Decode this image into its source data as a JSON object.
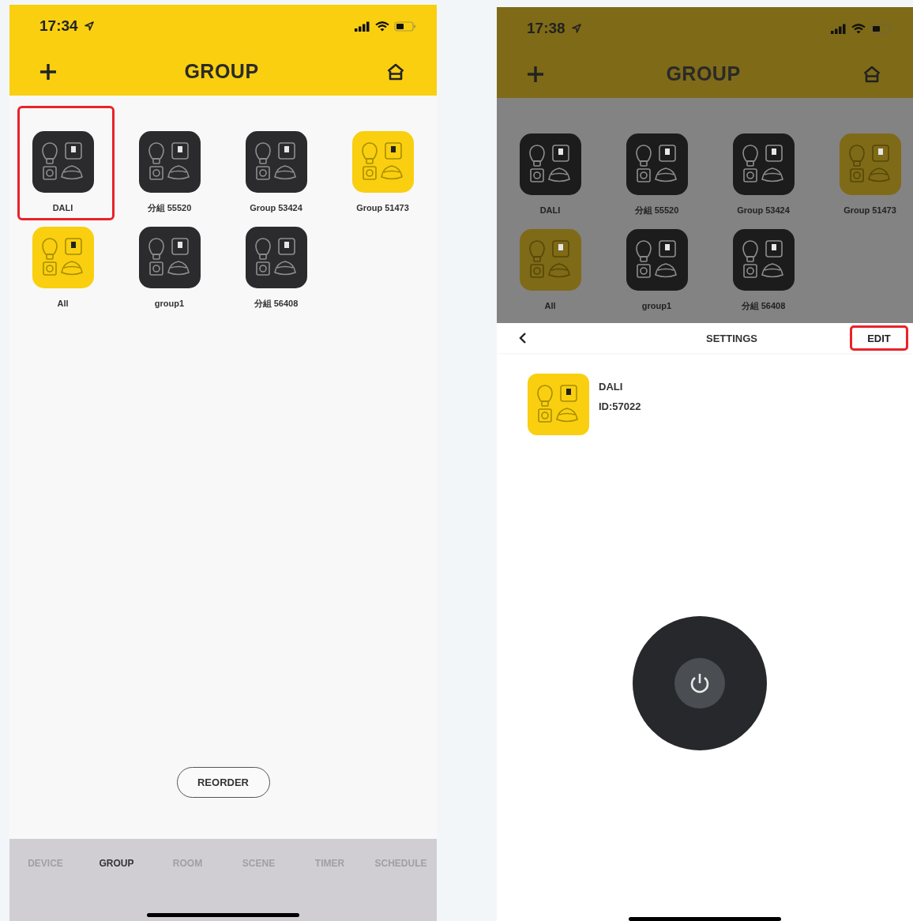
{
  "screens": [
    {
      "status_bar": {
        "time": "17:34"
      },
      "header": {
        "title": "GROUP"
      },
      "dimmed": false,
      "groups": [
        {
          "name": "DALI",
          "color": "#2b2b2d",
          "highlighted": true
        },
        {
          "name": "分組 55520",
          "color": "#2b2b2d",
          "highlighted": false
        },
        {
          "name": "Group 53424",
          "color": "#2b2b2d",
          "highlighted": false
        },
        {
          "name": "Group 51473",
          "color": "#f9cf10",
          "highlighted": false
        },
        {
          "name": "All",
          "color": "#f9cf10",
          "highlighted": false
        },
        {
          "name": "group1",
          "color": "#2b2b2d",
          "highlighted": false
        },
        {
          "name": "分組 56408",
          "color": "#2b2b2d",
          "highlighted": false
        }
      ],
      "reorder_button": "REORDER",
      "tab_bar": [
        {
          "label": "DEVICE",
          "selected": false
        },
        {
          "label": "GROUP",
          "selected": true
        },
        {
          "label": "ROOM",
          "selected": false
        },
        {
          "label": "SCENE",
          "selected": false
        },
        {
          "label": "TIMER",
          "selected": false
        },
        {
          "label": "SCHEDULE",
          "selected": false
        }
      ]
    },
    {
      "status_bar": {
        "time": "17:38"
      },
      "header": {
        "title": "GROUP"
      },
      "dimmed": true,
      "groups": [
        {
          "name": "DALI",
          "color": "#1c1c1d",
          "highlighted": false
        },
        {
          "name": "分組 55520",
          "color": "#1c1c1d",
          "highlighted": false
        },
        {
          "name": "Group 53424",
          "color": "#1c1c1d",
          "highlighted": false
        },
        {
          "name": "Group 51473",
          "color": "#7f6a17",
          "highlighted": false
        },
        {
          "name": "All",
          "color": "#7f6a17",
          "highlighted": false
        },
        {
          "name": "group1",
          "color": "#1c1c1d",
          "highlighted": false
        },
        {
          "name": "分組 56408",
          "color": "#1c1c1d",
          "highlighted": false
        }
      ],
      "settings_sheet": {
        "title": "SETTINGS",
        "edit_button": {
          "label": "EDIT",
          "highlighted": true
        },
        "device": {
          "name": "DALI",
          "id": "ID:57022",
          "color": "#f9cf10"
        }
      }
    }
  ]
}
